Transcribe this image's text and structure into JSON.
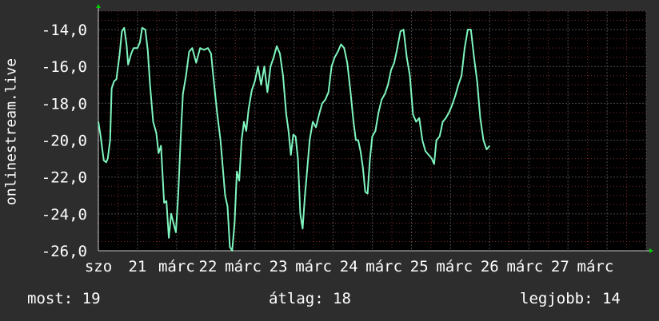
{
  "colors": {
    "background": "#2d2d2d",
    "plot_background": "#000000",
    "grid": "#4a4a4a",
    "grid_minor": "#7a2a2a",
    "line": "#7ff5bf",
    "axis_arrow": "#00cc00",
    "text": "#ffffff"
  },
  "stats": {
    "now": "most: 19",
    "avg": "átlag: 18",
    "best": "legjobb: 14"
  },
  "chart_data": {
    "type": "line",
    "ylabel": "onlinestream.live",
    "ylim": [
      -26,
      -13
    ],
    "xlim": [
      0,
      7
    ],
    "grid": true,
    "yticks": [
      -14,
      -16,
      -18,
      -20,
      -22,
      -24,
      -26
    ],
    "ytick_labels": [
      "-14,0",
      "-16,0",
      "-18,0",
      "-20,0",
      "-22,0",
      "-24,0",
      "-26,0"
    ],
    "xticks": [
      {
        "x": 0.0,
        "label": "szo"
      },
      {
        "x": 0.5,
        "label": "21"
      },
      {
        "x": 1.0,
        "label": "márc"
      },
      {
        "x": 1.4,
        "label": "22"
      },
      {
        "x": 1.85,
        "label": "márc"
      },
      {
        "x": 2.3,
        "label": "23"
      },
      {
        "x": 2.75,
        "label": "márc"
      },
      {
        "x": 3.2,
        "label": "24"
      },
      {
        "x": 3.65,
        "label": "márc"
      },
      {
        "x": 4.1,
        "label": "25"
      },
      {
        "x": 4.55,
        "label": "márc"
      },
      {
        "x": 5.0,
        "label": "26"
      },
      {
        "x": 5.45,
        "label": "márc"
      },
      {
        "x": 5.9,
        "label": "27"
      },
      {
        "x": 6.35,
        "label": "márc"
      }
    ],
    "series": [
      {
        "points": [
          [
            0.0,
            -19.0
          ],
          [
            0.03,
            -19.8
          ],
          [
            0.05,
            -20.5
          ],
          [
            0.07,
            -21.1
          ],
          [
            0.1,
            -21.2
          ],
          [
            0.12,
            -21.0
          ],
          [
            0.15,
            -20.0
          ],
          [
            0.17,
            -17.2
          ],
          [
            0.2,
            -16.8
          ],
          [
            0.23,
            -16.7
          ],
          [
            0.27,
            -15.4
          ],
          [
            0.3,
            -14.1
          ],
          [
            0.33,
            -13.9
          ],
          [
            0.36,
            -14.8
          ],
          [
            0.38,
            -15.9
          ],
          [
            0.42,
            -15.3
          ],
          [
            0.45,
            -15.0
          ],
          [
            0.5,
            -15.0
          ],
          [
            0.53,
            -14.7
          ],
          [
            0.56,
            -13.9
          ],
          [
            0.6,
            -14.0
          ],
          [
            0.63,
            -15.1
          ],
          [
            0.66,
            -17.0
          ],
          [
            0.7,
            -19.0
          ],
          [
            0.74,
            -19.6
          ],
          [
            0.77,
            -20.7
          ],
          [
            0.8,
            -20.3
          ],
          [
            0.84,
            -23.4
          ],
          [
            0.87,
            -23.3
          ],
          [
            0.9,
            -25.3
          ],
          [
            0.93,
            -24.0
          ],
          [
            0.96,
            -24.5
          ],
          [
            0.99,
            -25.0
          ],
          [
            1.02,
            -23.0
          ],
          [
            1.05,
            -20.0
          ],
          [
            1.08,
            -17.5
          ],
          [
            1.12,
            -16.5
          ],
          [
            1.16,
            -15.2
          ],
          [
            1.2,
            -15.0
          ],
          [
            1.25,
            -15.8
          ],
          [
            1.3,
            -15.0
          ],
          [
            1.35,
            -15.1
          ],
          [
            1.4,
            -15.0
          ],
          [
            1.44,
            -15.3
          ],
          [
            1.48,
            -17.0
          ],
          [
            1.52,
            -18.6
          ],
          [
            1.56,
            -20.0
          ],
          [
            1.59,
            -21.5
          ],
          [
            1.62,
            -23.0
          ],
          [
            1.65,
            -23.6
          ],
          [
            1.68,
            -25.8
          ],
          [
            1.71,
            -26.0
          ],
          [
            1.74,
            -24.5
          ],
          [
            1.77,
            -21.7
          ],
          [
            1.8,
            -22.2
          ],
          [
            1.83,
            -20.0
          ],
          [
            1.86,
            -19.0
          ],
          [
            1.89,
            -19.5
          ],
          [
            1.92,
            -18.3
          ],
          [
            1.96,
            -17.3
          ],
          [
            2.0,
            -16.8
          ],
          [
            2.04,
            -16.0
          ],
          [
            2.08,
            -17.0
          ],
          [
            2.12,
            -16.0
          ],
          [
            2.16,
            -17.4
          ],
          [
            2.2,
            -16.0
          ],
          [
            2.24,
            -15.5
          ],
          [
            2.28,
            -14.9
          ],
          [
            2.32,
            -15.3
          ],
          [
            2.36,
            -16.5
          ],
          [
            2.4,
            -18.6
          ],
          [
            2.43,
            -19.5
          ],
          [
            2.46,
            -20.8
          ],
          [
            2.49,
            -19.7
          ],
          [
            2.52,
            -19.8
          ],
          [
            2.55,
            -21.0
          ],
          [
            2.58,
            -24.0
          ],
          [
            2.61,
            -24.8
          ],
          [
            2.64,
            -23.0
          ],
          [
            2.67,
            -21.5
          ],
          [
            2.7,
            -20.0
          ],
          [
            2.74,
            -19.0
          ],
          [
            2.78,
            -19.3
          ],
          [
            2.82,
            -18.6
          ],
          [
            2.86,
            -18.0
          ],
          [
            2.9,
            -17.8
          ],
          [
            2.94,
            -17.4
          ],
          [
            2.98,
            -16.0
          ],
          [
            3.02,
            -15.5
          ],
          [
            3.06,
            -15.2
          ],
          [
            3.1,
            -14.8
          ],
          [
            3.14,
            -15.0
          ],
          [
            3.18,
            -15.8
          ],
          [
            3.22,
            -17.3
          ],
          [
            3.26,
            -19.0
          ],
          [
            3.29,
            -20.0
          ],
          [
            3.32,
            -20.0
          ],
          [
            3.35,
            -20.6
          ],
          [
            3.38,
            -21.5
          ],
          [
            3.41,
            -22.8
          ],
          [
            3.44,
            -22.9
          ],
          [
            3.47,
            -21.0
          ],
          [
            3.5,
            -19.8
          ],
          [
            3.54,
            -19.5
          ],
          [
            3.58,
            -18.5
          ],
          [
            3.62,
            -17.8
          ],
          [
            3.66,
            -17.5
          ],
          [
            3.7,
            -17.0
          ],
          [
            3.74,
            -16.2
          ],
          [
            3.78,
            -15.8
          ],
          [
            3.82,
            -15.0
          ],
          [
            3.86,
            -14.1
          ],
          [
            3.9,
            -14.0
          ],
          [
            3.94,
            -15.5
          ],
          [
            3.98,
            -16.5
          ],
          [
            4.02,
            -18.6
          ],
          [
            4.06,
            -19.0
          ],
          [
            4.1,
            -18.8
          ],
          [
            4.14,
            -20.0
          ],
          [
            4.18,
            -20.6
          ],
          [
            4.22,
            -20.8
          ],
          [
            4.26,
            -21.0
          ],
          [
            4.29,
            -21.3
          ],
          [
            4.32,
            -20.0
          ],
          [
            4.36,
            -19.8
          ],
          [
            4.4,
            -19.0
          ],
          [
            4.44,
            -18.8
          ],
          [
            4.48,
            -18.5
          ],
          [
            4.52,
            -18.1
          ],
          [
            4.56,
            -17.6
          ],
          [
            4.6,
            -17.0
          ],
          [
            4.64,
            -16.5
          ],
          [
            4.68,
            -15.0
          ],
          [
            4.72,
            -14.0
          ],
          [
            4.76,
            -14.0
          ],
          [
            4.8,
            -15.5
          ],
          [
            4.84,
            -16.8
          ],
          [
            4.88,
            -18.8
          ],
          [
            4.92,
            -20.0
          ],
          [
            4.96,
            -20.5
          ],
          [
            5.0,
            -20.3
          ]
        ]
      }
    ]
  }
}
